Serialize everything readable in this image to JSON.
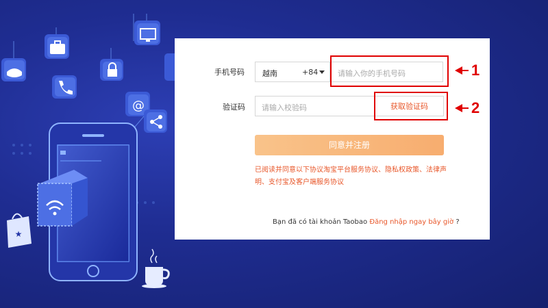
{
  "form": {
    "phone_label": "手机号码",
    "country_name": "越南",
    "country_code": "+84",
    "phone_placeholder": "请输入你的手机号码",
    "code_label": "验证码",
    "code_placeholder": "请输入校验码",
    "get_code_label": "获取验证码",
    "submit_label": "同意并注册",
    "agreement_prefix": "已阅读并同意以下协议",
    "agreement_links": "淘宝平台服务协议、隐私权政策、法律声明、支付宝及客户端服务协议",
    "login_prompt": "Bạn đã có tài khoản Taobao",
    "login_link": "Đăng nhập ngay bây giờ",
    "login_suffix": "?"
  },
  "annotations": {
    "marker_1": "1",
    "marker_2": "2"
  },
  "colors": {
    "accent": "#e8572a",
    "annotation_red": "#e00000",
    "submit_bg": "#f7b97b",
    "background": "#1f2d92"
  },
  "icons": [
    "gamepad-icon",
    "briefcase-icon",
    "tv-icon",
    "lock-icon",
    "phone-call-icon",
    "at-sign-icon",
    "share-icon",
    "wifi-icon",
    "shopping-bag-icon",
    "coffee-cup-icon",
    "smartphone-illustration"
  ]
}
